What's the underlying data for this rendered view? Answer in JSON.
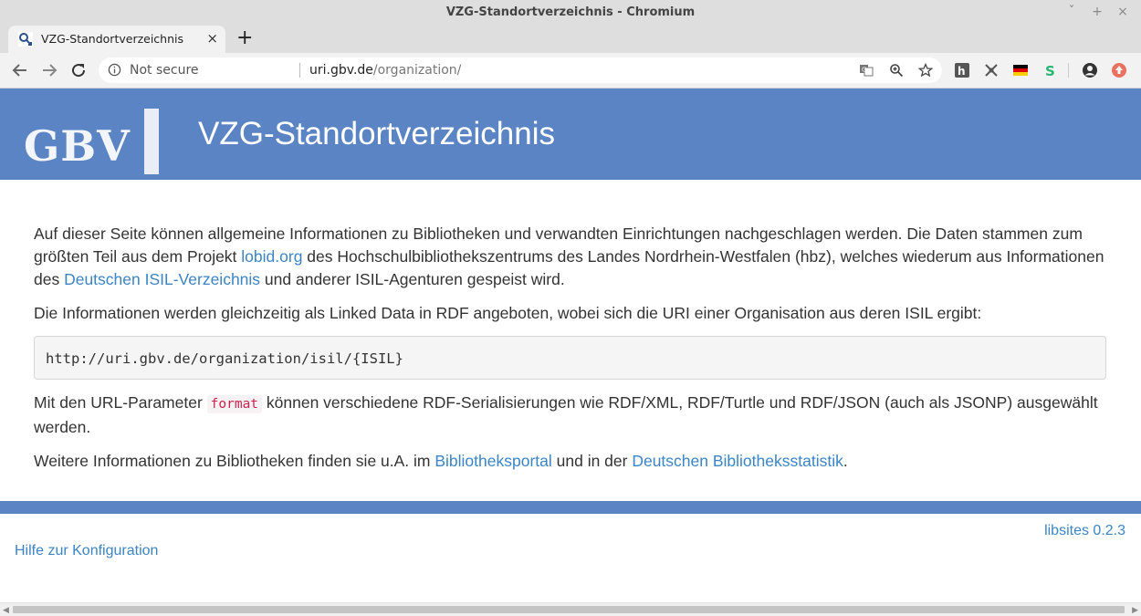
{
  "window": {
    "title": "VZG-Standortverzeichnis - Chromium",
    "controls": [
      "ˇ",
      "+",
      "×"
    ]
  },
  "tab": {
    "title": "VZG-Standortverzeichnis",
    "close": "×"
  },
  "newtab": "+",
  "omnibox": {
    "security": "Not secure",
    "host": "uri.gbv.de",
    "path": "/organization/"
  },
  "header": {
    "logo": "GBV",
    "title": "VZG-Standortverzeichnis"
  },
  "content": {
    "p1_a": "Auf dieser Seite können allgemeine Informationen zu Bibliotheken und verwandten Einrichtungen nachgeschlagen werden. Die Daten stammen zum größten Teil aus dem Projekt ",
    "p1_link1": "lobid.org",
    "p1_b": " des Hochschulbibliothekszentrums des Landes Nordrhein-Westfalen (hbz), welches wiederum aus Informationen des ",
    "p1_link2": "Deutschen ISIL-Verzeichnis",
    "p1_c": " und anderer ISIL-Agenturen gespeist wird.",
    "p2": "Die Informationen werden gleichzeitig als Linked Data in RDF angeboten, wobei sich die URI einer Organisation aus deren ISIL ergibt:",
    "code": "http://uri.gbv.de/organization/isil/{ISIL}",
    "p3_a": "Mit den URL-Parameter ",
    "p3_code": "format",
    "p3_b": " können verschiedene RDF-Serialisierungen wie RDF/XML, RDF/Turtle und RDF/JSON (auch als JSONP) ausgewählt werden.",
    "p4_a": "Weitere Informationen zu Bibliotheken finden sie u.A. im ",
    "p4_link1": "Bibliotheksportal",
    "p4_b": " und in der ",
    "p4_link2": "Deutschen Bibliotheksstatistik",
    "p4_c": "."
  },
  "footer": {
    "version": "libsites 0.2.3",
    "help": "Hilfe zur Konfiguration"
  },
  "colors": {
    "brand": "#5b84c4",
    "link": "#3c84c4",
    "code": "#c7254e"
  }
}
